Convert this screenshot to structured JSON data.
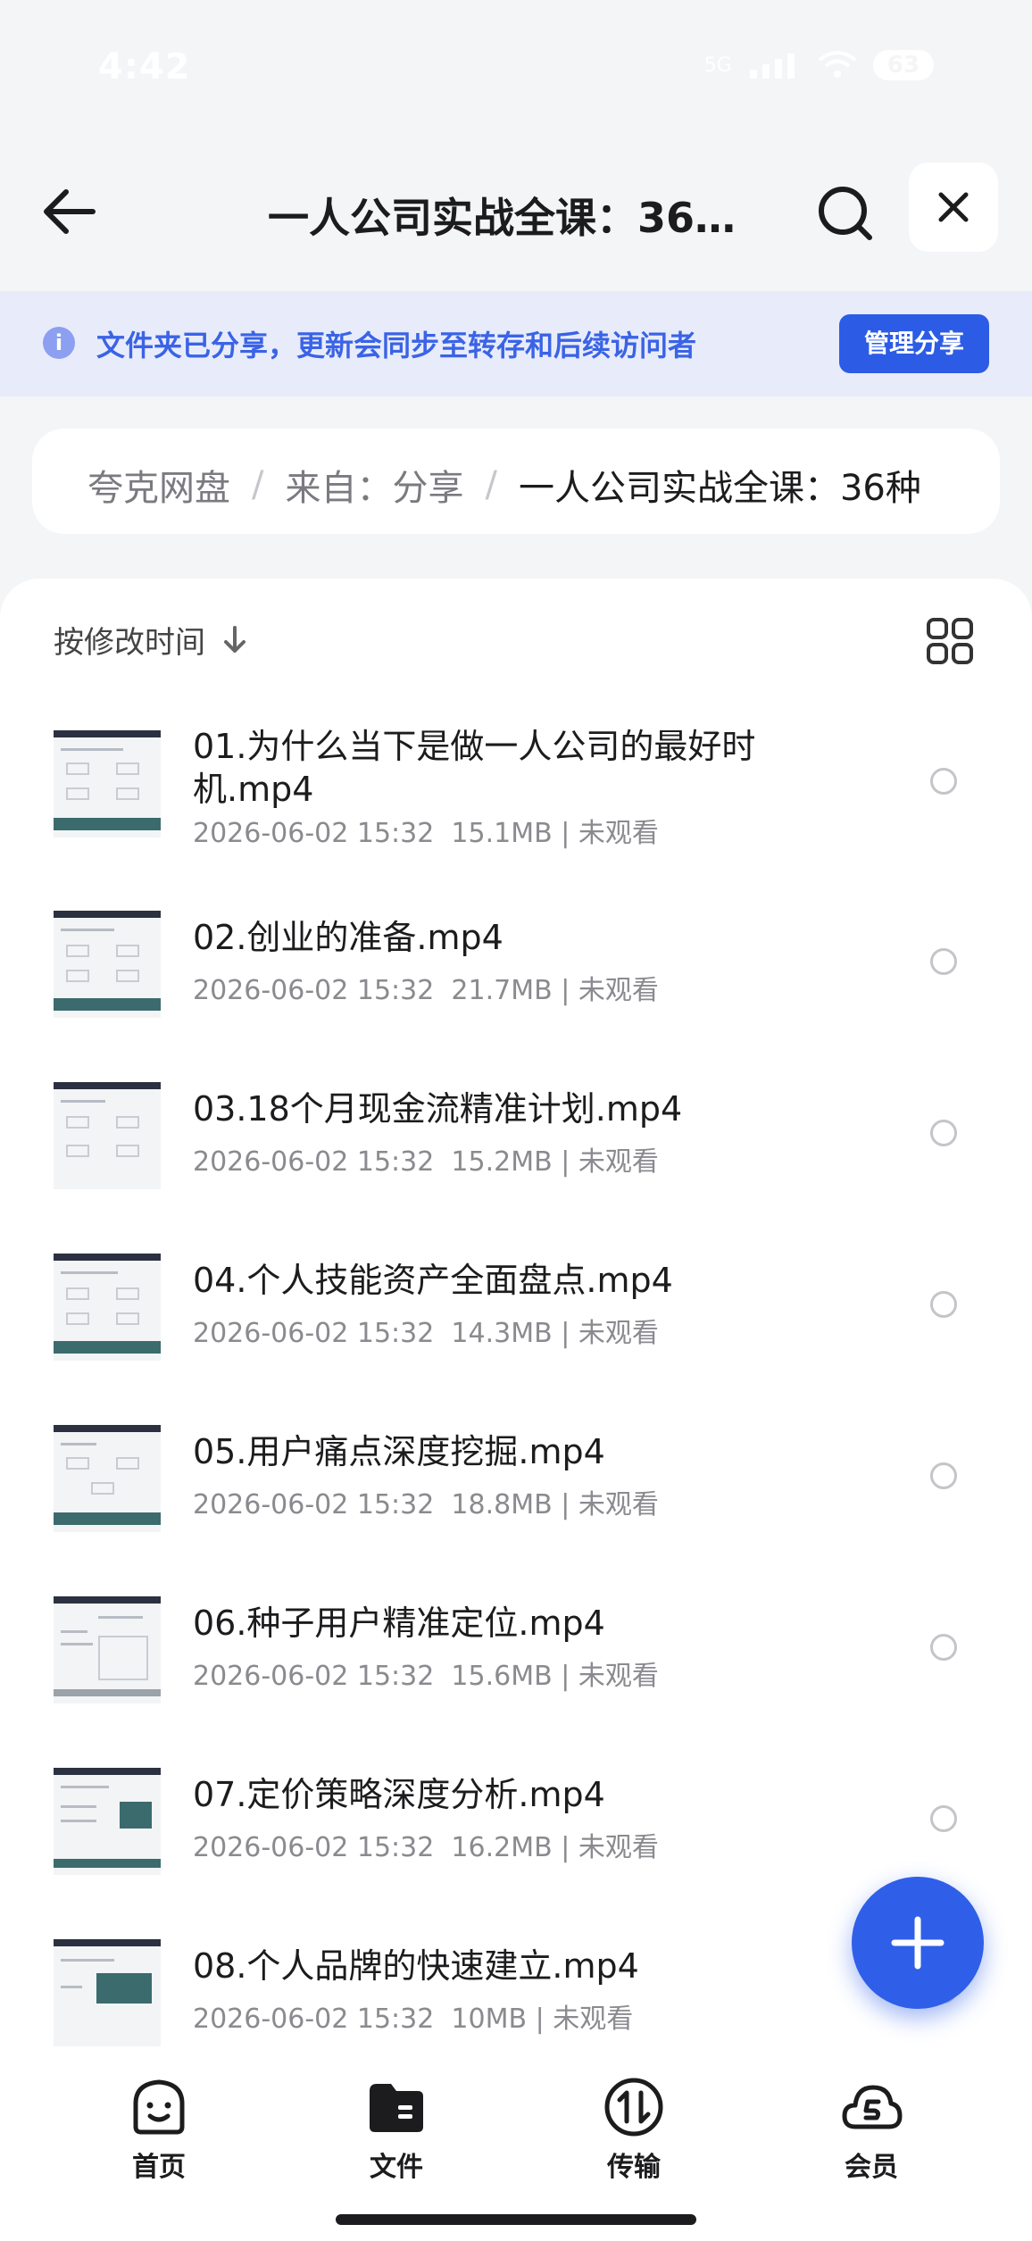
{
  "status_bar": {
    "time": "4:42",
    "network": "5G",
    "battery": "63"
  },
  "header": {
    "title": "一人公司实战全课：36…"
  },
  "banner": {
    "text": "文件夹已分享，更新会同步至转存和后续访问者",
    "button": "管理分享"
  },
  "breadcrumb": [
    "夸克网盘",
    "来自：分享",
    "一人公司实战全课：36种"
  ],
  "sort": {
    "label": "按修改时间"
  },
  "files": [
    {
      "name": "01.为什么当下是做一人公司的最好时机.mp4",
      "date": "2026-06-02 15:32",
      "size": "15.1MB",
      "status": "未观看"
    },
    {
      "name": "02.创业的准备.mp4",
      "date": "2026-06-02 15:32",
      "size": "21.7MB",
      "status": "未观看"
    },
    {
      "name": "03.18个月现金流精准计划.mp4",
      "date": "2026-06-02 15:32",
      "size": "15.2MB",
      "status": "未观看"
    },
    {
      "name": "04.个人技能资产全面盘点.mp4",
      "date": "2026-06-02 15:32",
      "size": "14.3MB",
      "status": "未观看"
    },
    {
      "name": "05.用户痛点深度挖掘.mp4",
      "date": "2026-06-02 15:32",
      "size": "18.8MB",
      "status": "未观看"
    },
    {
      "name": "06.种子用户精准定位.mp4",
      "date": "2026-06-02 15:32",
      "size": "15.6MB",
      "status": "未观看"
    },
    {
      "name": "07.定价策略深度分析.mp4",
      "date": "2026-06-02 15:32",
      "size": "16.2MB",
      "status": "未观看"
    },
    {
      "name": "08.个人品牌的快速建立.mp4",
      "date": "2026-06-02 15:32",
      "size": "10MB",
      "status": "未观看"
    }
  ],
  "tabs": [
    {
      "label": "首页",
      "icon": "smile-face-icon"
    },
    {
      "label": "文件",
      "icon": "folder-icon"
    },
    {
      "label": "传输",
      "icon": "transfer-icon"
    },
    {
      "label": "会员",
      "icon": "cloud-vip-icon"
    }
  ],
  "colors": {
    "accent": "#2c5ce6",
    "banner_bg": "#e8ecfa",
    "banner_text": "#3a63e6"
  }
}
